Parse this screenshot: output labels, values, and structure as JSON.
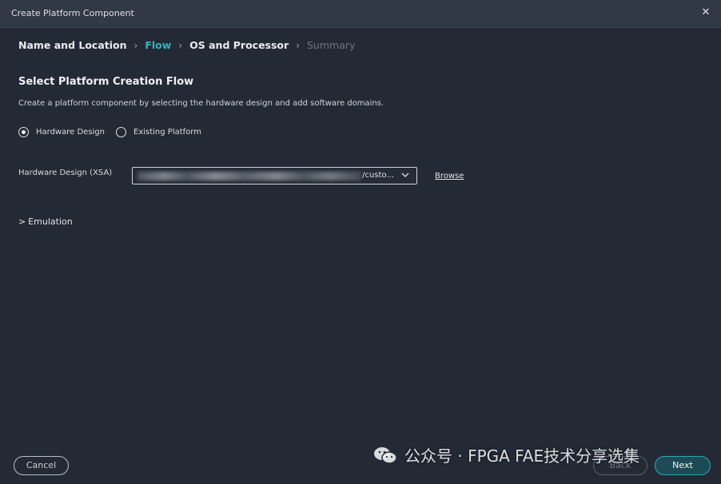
{
  "window": {
    "title": "Create Platform Component",
    "close_icon": "close-icon"
  },
  "breadcrumb": {
    "steps": [
      {
        "label": "Name and Location",
        "state": "done"
      },
      {
        "label": "Flow",
        "state": "active"
      },
      {
        "label": "OS and Processor",
        "state": "done"
      },
      {
        "label": "Summary",
        "state": "disabled"
      }
    ],
    "separator_icon": "chevron-right-icon"
  },
  "main": {
    "heading": "Select Platform Creation Flow",
    "description": "Create a platform component by selecting the hardware design and add software domains.",
    "flow_options": [
      {
        "label": "Hardware Design",
        "checked": true
      },
      {
        "label": "Existing Platform",
        "checked": false
      }
    ],
    "xsa": {
      "label": "Hardware Design (XSA)",
      "visible_value_tail": "/custo...",
      "dropdown_icon": "chevron-down-icon",
      "browse_label": "Browse"
    },
    "emulation": {
      "label": "Emulation",
      "chevron": ">"
    }
  },
  "footer": {
    "cancel_label": "Cancel",
    "back_label": "Back",
    "next_label": "Next"
  },
  "watermark": {
    "text": "公众号 · FPGA FAE技术分享选集",
    "icon": "wechat-icon"
  },
  "colors": {
    "background": "#242a35",
    "titlebar": "#313846",
    "accent": "#2fb5c2",
    "disabled_text": "#6d7482"
  }
}
